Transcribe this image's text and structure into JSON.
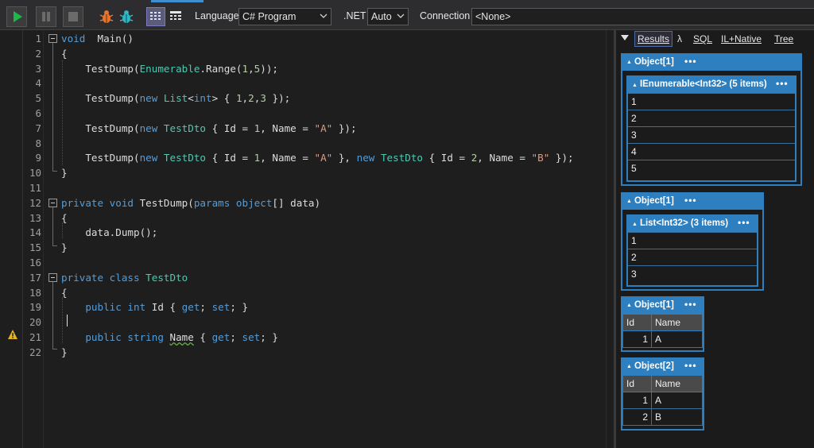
{
  "toolbar": {
    "language_label": "Language",
    "language_value": "C# Program",
    "dotnet_label": ".NET",
    "dotnet_value": "Auto",
    "connection_label": "Connection",
    "connection_value": "<None>",
    "icons": [
      "run-icon",
      "pause-icon",
      "stop-icon",
      "bug-orange-icon",
      "bug-teal-icon",
      "grid-results-icon",
      "text-results-icon",
      "chevron-down-icon"
    ]
  },
  "editor": {
    "line_numbers": [
      "1",
      "2",
      "3",
      "4",
      "5",
      "6",
      "7",
      "8",
      "9",
      "10",
      "11",
      "12",
      "13",
      "14",
      "15",
      "16",
      "17",
      "18",
      "19",
      "20",
      "21",
      "22"
    ],
    "lines": [
      {
        "n": 1,
        "segments": [
          [
            "kw",
            "void"
          ],
          [
            "",
            "  Main()"
          ]
        ]
      },
      {
        "n": 2,
        "segments": [
          [
            "",
            "{"
          ]
        ]
      },
      {
        "n": 3,
        "segments": [
          [
            "",
            "    TestDump("
          ],
          [
            "ty",
            "Enumerable"
          ],
          [
            "",
            ".Range("
          ],
          [
            "nu",
            "1"
          ],
          [
            "",
            ","
          ],
          [
            "nu",
            "5"
          ],
          [
            "",
            "));"
          ]
        ]
      },
      {
        "n": 4,
        "segments": []
      },
      {
        "n": 5,
        "segments": [
          [
            "",
            "    TestDump("
          ],
          [
            "kw",
            "new"
          ],
          [
            "ty",
            " List"
          ],
          [
            "",
            "<"
          ],
          [
            "kw",
            "int"
          ],
          [
            "",
            "> { "
          ],
          [
            "nu",
            "1"
          ],
          [
            "",
            ","
          ],
          [
            "nu",
            "2"
          ],
          [
            "",
            ","
          ],
          [
            "nu",
            "3"
          ],
          [
            "",
            " });"
          ]
        ]
      },
      {
        "n": 6,
        "segments": []
      },
      {
        "n": 7,
        "segments": [
          [
            "",
            "    TestDump("
          ],
          [
            "kw",
            "new"
          ],
          [
            "ty",
            " TestDto"
          ],
          [
            "",
            " { Id = "
          ],
          [
            "nu",
            "1"
          ],
          [
            "",
            ", Name = "
          ],
          [
            "st",
            "\"A\""
          ],
          [
            "",
            " });"
          ]
        ]
      },
      {
        "n": 8,
        "segments": []
      },
      {
        "n": 9,
        "segments": [
          [
            "",
            "    TestDump("
          ],
          [
            "kw",
            "new"
          ],
          [
            "ty",
            " TestDto"
          ],
          [
            "",
            " { Id = "
          ],
          [
            "nu",
            "1"
          ],
          [
            "",
            ", Name = "
          ],
          [
            "st",
            "\"A\""
          ],
          [
            "",
            " }, "
          ],
          [
            "kw",
            "new"
          ],
          [
            "ty",
            " TestDto"
          ],
          [
            "",
            " { Id = "
          ],
          [
            "nu",
            "2"
          ],
          [
            "",
            ", Name = "
          ],
          [
            "st",
            "\"B\""
          ],
          [
            "",
            " });"
          ]
        ]
      },
      {
        "n": 10,
        "segments": [
          [
            "",
            "}"
          ]
        ]
      },
      {
        "n": 11,
        "segments": []
      },
      {
        "n": 12,
        "segments": [
          [
            "kw",
            "private void"
          ],
          [
            "",
            " TestDump("
          ],
          [
            "kw",
            "params object"
          ],
          [
            "",
            "[] data)"
          ]
        ]
      },
      {
        "n": 13,
        "segments": [
          [
            "",
            "{"
          ]
        ]
      },
      {
        "n": 14,
        "segments": [
          [
            "",
            "    data.Dump();"
          ]
        ]
      },
      {
        "n": 15,
        "segments": [
          [
            "",
            "}"
          ]
        ]
      },
      {
        "n": 16,
        "segments": []
      },
      {
        "n": 17,
        "segments": [
          [
            "kw",
            "private class"
          ],
          [
            "ty",
            " TestDto"
          ]
        ]
      },
      {
        "n": 18,
        "segments": [
          [
            "",
            "{"
          ]
        ]
      },
      {
        "n": 19,
        "segments": [
          [
            "kw",
            "    public int"
          ],
          [
            "",
            " Id { "
          ],
          [
            "kw",
            "get"
          ],
          [
            "",
            "; "
          ],
          [
            "kw",
            "set"
          ],
          [
            "",
            "; }"
          ]
        ]
      },
      {
        "n": 20,
        "segments": []
      },
      {
        "n": 21,
        "segments": [
          [
            "kw",
            "    public string"
          ],
          [
            "",
            " "
          ],
          [
            "warn",
            "Name"
          ],
          [
            "",
            " { "
          ],
          [
            "kw",
            "get"
          ],
          [
            "",
            "; "
          ],
          [
            "kw",
            "set"
          ],
          [
            "",
            "; }"
          ]
        ]
      },
      {
        "n": 22,
        "segments": [
          [
            "",
            "}"
          ]
        ]
      }
    ]
  },
  "results_tabs": {
    "results": "Results",
    "lambda": "λ",
    "sql": "SQL",
    "il": "IL+Native",
    "tree": "Tree"
  },
  "dumps": {
    "d1": {
      "title": "Object[1]",
      "inner_title": "IEnumerable<Int32> (5 items)",
      "rows": [
        "1",
        "2",
        "3",
        "4",
        "5"
      ]
    },
    "d2": {
      "title": "Object[1]",
      "inner_title": "List<Int32> (3 items)",
      "rows": [
        "1",
        "2",
        "3"
      ]
    },
    "d3": {
      "title": "Object[1]",
      "col_id": "Id",
      "col_name": "Name",
      "rows": [
        {
          "id": "1",
          "name": "A"
        }
      ]
    },
    "d4": {
      "title": "Object[2]",
      "col_id": "Id",
      "col_name": "Name",
      "rows": [
        {
          "id": "1",
          "name": "A"
        },
        {
          "id": "2",
          "name": "B"
        }
      ]
    },
    "more": "•••"
  }
}
